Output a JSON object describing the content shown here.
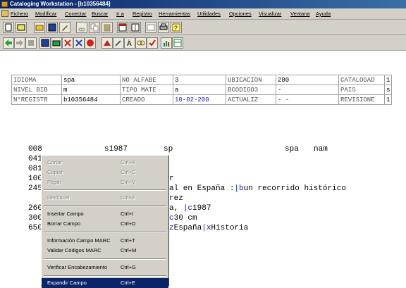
{
  "window": {
    "title": "Cataloging Workstation - [b10356484]"
  },
  "menubar": [
    "Fichero",
    "Modificar",
    "Conectar",
    "Buscar",
    "Ir a",
    "Registro",
    "Herramientas",
    "Utilidades",
    "Opciones",
    "Visualizar",
    "Ventana",
    "Ayuda"
  ],
  "fields": {
    "rows": [
      [
        {
          "label": "IDIOMA",
          "value": "spa"
        },
        {
          "label": "NO ALFABE",
          "value": "3"
        },
        {
          "label": "UBICACION",
          "value": "280"
        },
        {
          "label": "CATALOGAD",
          "value": "1"
        }
      ],
      [
        {
          "label": "NIVEL BIB",
          "value": "m"
        },
        {
          "label": "TIPO MATE",
          "value": "a"
        },
        {
          "label": "BCODIGO3",
          "value": "-"
        },
        {
          "label": "PAIS",
          "value": "s"
        }
      ],
      [
        {
          "label": "N°REGISTR",
          "value": "b10356484"
        },
        {
          "label": "CREADO",
          "value": "10-02-200"
        },
        {
          "label": "ACTUALIZ",
          "value": "-  -"
        },
        {
          "label": "REVISIONE",
          "value": "1"
        }
      ]
    ]
  },
  "marc": {
    "first_line": {
      "tag": "008",
      "date": "s1987",
      "place": "sp",
      "lang": "spa",
      "code": "nam"
    },
    "tags": [
      "041",
      "081",
      "100",
      "245",
      "",
      "260",
      "300",
      "650"
    ],
    "frags": {
      "l100": "r",
      "l245a": "al en España :",
      "l245b": "|b",
      "l245c": "un recorrido histórico",
      "l245d": "rez",
      "l260a": "a, ",
      "l260b": "|c",
      "l260c": "1987",
      "l300a": "c",
      "l300b": "30 cm",
      "l650a": "z",
      "l650b": "España",
      "l650c": "|x",
      "l650d": "Historia"
    }
  },
  "context_menu": {
    "items": [
      {
        "label": "Cortar",
        "shortcut": "Ctrl+X"
      },
      {
        "label": "Copiar",
        "shortcut": "Ctrl+C"
      },
      {
        "label": "Pegar",
        "shortcut": "Ctrl+V"
      },
      {
        "label": "Deshacer",
        "shortcut": "Ctrl+Z"
      },
      {
        "label": "Insertar Campo",
        "shortcut": "Ctrl+I"
      },
      {
        "label": "Borrar Campo",
        "shortcut": "Ctrl+D"
      },
      {
        "label": "Información Campo MARC",
        "shortcut": "Ctrl+T"
      },
      {
        "label": "Validar Códigos MARC",
        "shortcut": "Ctrl+M"
      },
      {
        "label": "Verificar Encabezamiento",
        "shortcut": "Ctrl+G"
      },
      {
        "label": "Expandir Campo",
        "shortcut": "Ctrl+E"
      }
    ]
  },
  "colors": {
    "title_bar": "#0a246a",
    "subfield_blue": "#1020c0",
    "menu_highlight": "#0a246a"
  }
}
